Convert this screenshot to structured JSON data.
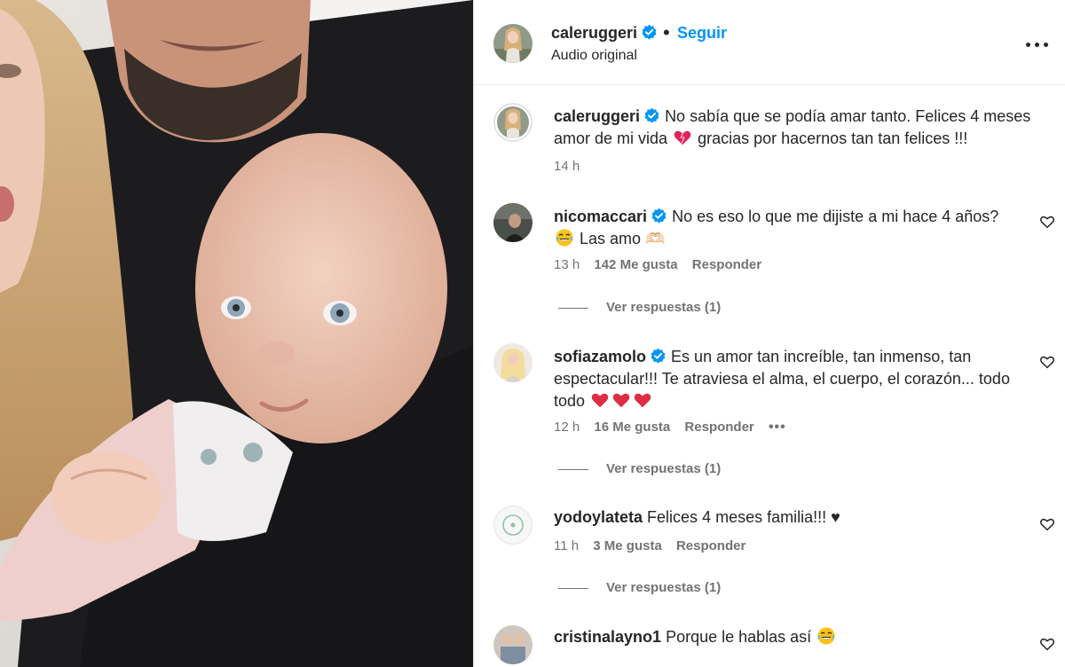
{
  "post": {
    "username": "caleruggeri",
    "follow_label": "Seguir",
    "dot": "•",
    "audio_label": "Audio original",
    "caption_part1": "No sabía que se podía amar tanto. Felices 4 meses amor de mi vida",
    "caption_part2": "gracias por hacernos tan tan felices !!!",
    "caption_time": "14 h"
  },
  "comments": [
    {
      "username": "nicomaccari",
      "text_part1": "No es eso lo que me dijiste a mi hace 4 años?",
      "text_part2": "Las amo 🫶🏻",
      "time": "13 h",
      "likes": "142 Me gusta",
      "reply_label": "Responder",
      "replies_label": "Ver respuestas (1)"
    },
    {
      "username": "sofiazamolo",
      "text": "Es un amor tan increíble, tan inmenso, tan espectacular!!! Te atraviesa el alma, el cuerpo, el corazón... todo todo",
      "time": "12 h",
      "likes": "16 Me gusta",
      "reply_label": "Responder",
      "more_label": "•••",
      "replies_label": "Ver respuestas (1)"
    },
    {
      "username": "yodoylateta",
      "text": "Felices 4 meses familia!!! ♥",
      "time": "11 h",
      "likes": "3 Me gusta",
      "reply_label": "Responder",
      "replies_label": "Ver respuestas (1)"
    },
    {
      "username": "cristinalayno1",
      "text": "Porque le hablas así"
    }
  ],
  "colors": {
    "accent": "#0095f6",
    "text": "#262626",
    "secondary": "#737373",
    "heart": "#e0245e",
    "verified": "#0095f6"
  },
  "icons": [
    "verified-badge-icon",
    "more-options-icon",
    "heart-outline-icon",
    "red-heart-emoji",
    "tears-of-joy-emoji",
    "heart-hands-emoji"
  ]
}
